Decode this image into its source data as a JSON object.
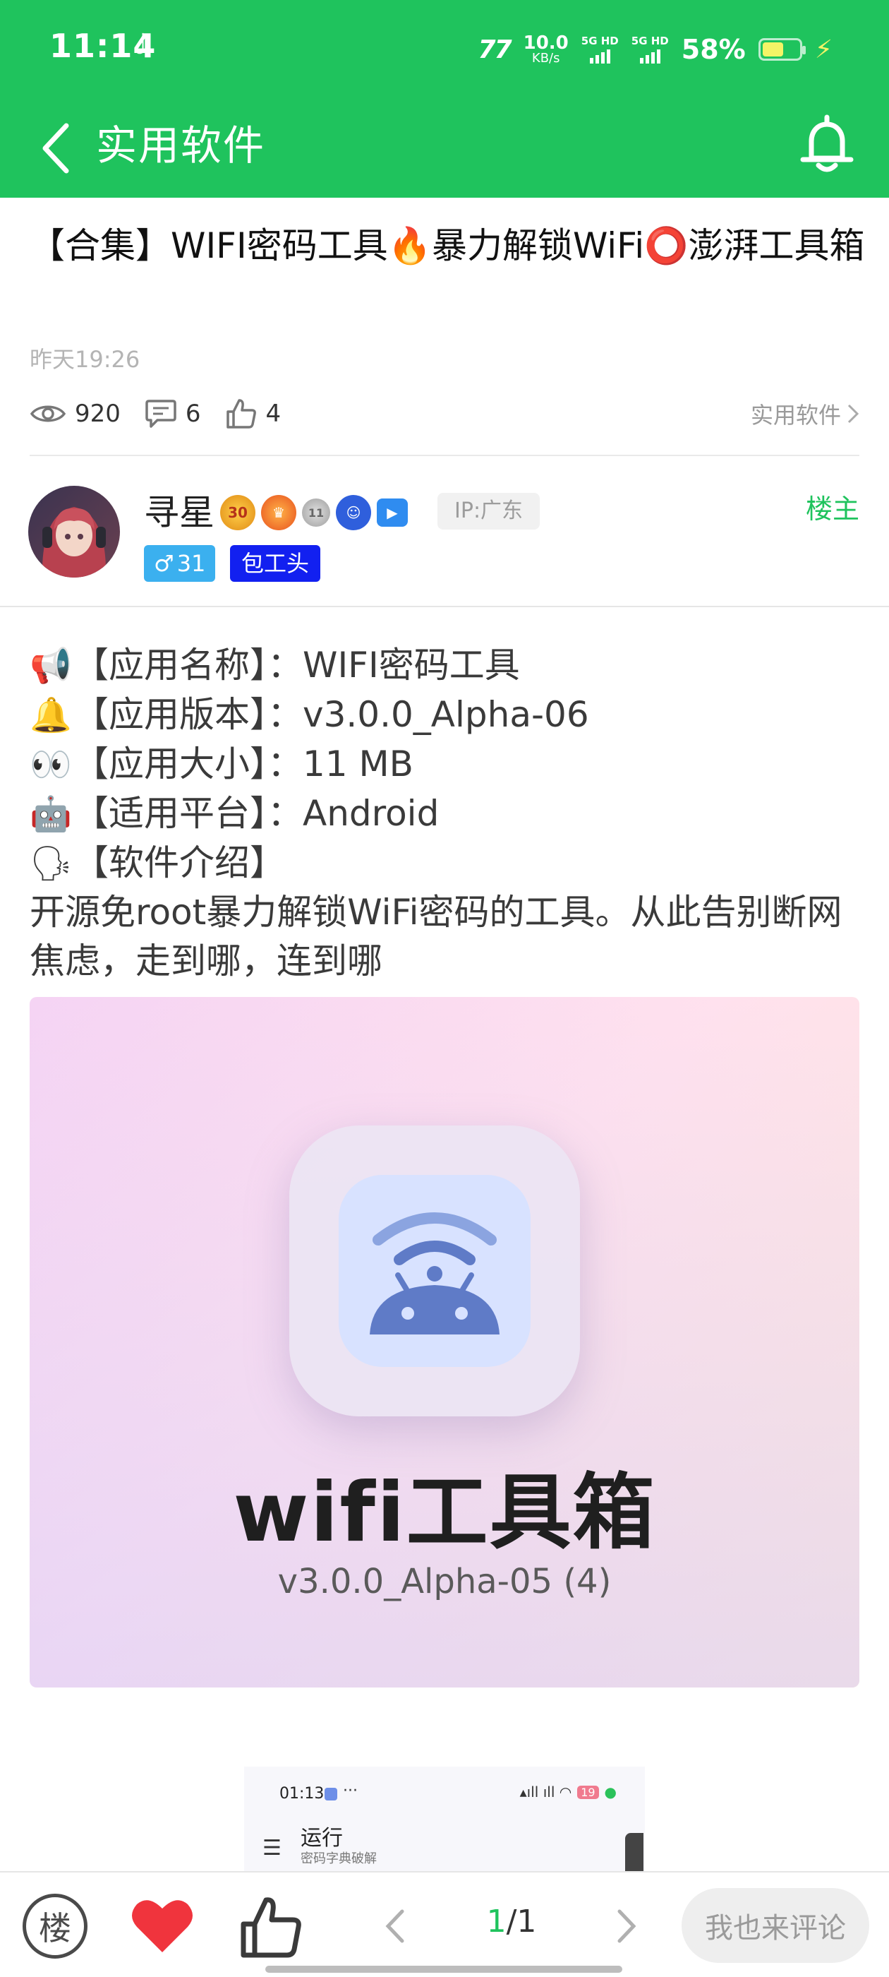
{
  "status_bar": {
    "time": "11:14",
    "tiktok": "♪",
    "brand": "77",
    "speed_value": "10.0",
    "speed_unit": "KB/s",
    "sim1_type": "5G HD",
    "sim2_type": "5G HD",
    "battery_percent": "58%",
    "battery_level": 0.58,
    "charging": true
  },
  "app_bar": {
    "title": "实用软件",
    "back_icon": "chevron-left-icon",
    "bell_icon": "bell-icon"
  },
  "post": {
    "title": "【合集】WIFI密码工具🔥暴力解锁WiFi⭕澎湃工具箱",
    "time": "昨天19:26",
    "views": "920",
    "comments": "6",
    "likes": "4",
    "category": "实用软件"
  },
  "author": {
    "name": "寻星",
    "ip": "IP:广东",
    "role": "楼主",
    "gender_level": "31",
    "gender_symbol": "♂",
    "title_tag": "包工头",
    "badge_30": "30",
    "badge_11": "11"
  },
  "content": {
    "lines": [
      {
        "emoji": "📢",
        "text": "【应用名称】：WIFI密码工具"
      },
      {
        "emoji": "🔔",
        "text": "【应用版本】：v3.0.0_Alpha-06"
      },
      {
        "emoji": "👀",
        "text": "【应用大小】：11 MB"
      },
      {
        "emoji": "🤖",
        "text": "【适用平台】：Android"
      },
      {
        "emoji": "🗣",
        "text": "【软件介绍】"
      }
    ],
    "description": "开源免root暴力解锁WiFi密码的工具。从此告别断网焦虑，走到哪，连到哪"
  },
  "banner": {
    "app_name": "wifi工具箱",
    "version": "v3.0.0_Alpha-05 (4)"
  },
  "screenshot": {
    "time": "01:13",
    "dots": "···",
    "battery": "19",
    "title": "运行",
    "subtitle": "密码字典破解"
  },
  "bottom_bar": {
    "floor_label": "楼",
    "page_current": "1",
    "page_total": "/1",
    "comment_placeholder": "我也来评论"
  },
  "colors": {
    "brand_green": "#1fc35d",
    "heart_red": "#f0343d",
    "title_tag_blue": "#1220f0",
    "gender_blue": "#3bb0ef"
  }
}
